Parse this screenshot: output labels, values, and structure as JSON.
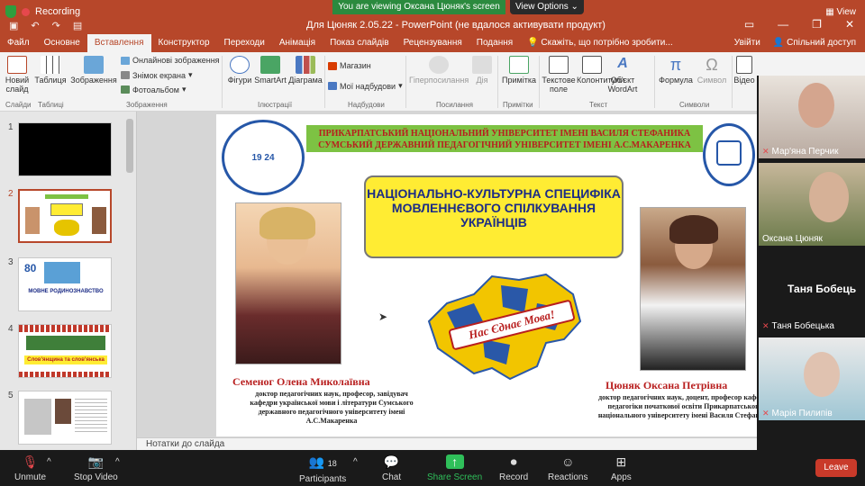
{
  "window": {
    "recording": "Recording",
    "viewing_banner": "You are viewing Оксана Цюняк's screen",
    "view_options": "View Options",
    "doc_title": "Для Цюняк  2.05.22 - PowerPoint (не вдалося активувати продукт)",
    "view_label": "View"
  },
  "tabs": [
    "Файл",
    "Основне",
    "Вставлення",
    "Конструктор",
    "Переходи",
    "Анімація",
    "Показ слайдів",
    "Рецензування",
    "Подання"
  ],
  "active_tab": "Вставлення",
  "tell_me": "Скажіть, що потрібно зробити...",
  "signin": "Увійти",
  "share": "Спільний доступ",
  "ribbon": {
    "new_slide": "Новий слайд",
    "table": "Таблиця",
    "images": "Зображення",
    "online_images": "Онлайнові зображення",
    "screenshot": "Знімок екрана",
    "photo_album": "Фотоальбом",
    "shapes": "Фігури",
    "smartart": "SmartArt",
    "chart": "Діаграма",
    "store": "Магазин",
    "my_addins": "Мої надбудови",
    "hyperlink": "Гіперпосилання",
    "action": "Дія",
    "comment": "Примітка",
    "textbox": "Текстове поле",
    "header_footer": "Колонтитули",
    "wordart": "Об'єкт WordArt",
    "equation": "Формула",
    "symbol": "Символ",
    "video": "Відео",
    "groups": {
      "slides": "Слайди",
      "tables": "Таблиці",
      "images": "Зображення",
      "illustrations": "Ілюстрації",
      "addins": "Надбудови",
      "links": "Посилання",
      "comments": "Примітки",
      "text": "Текст",
      "symbols": "Символи"
    }
  },
  "thumbnails": [
    {
      "num": "1"
    },
    {
      "num": "2"
    },
    {
      "num": "3",
      "caption": "МОВНЕ РОДИНОЗНАВСТВО"
    },
    {
      "num": "4",
      "caption": "Слов'янщина та слов'янська"
    },
    {
      "num": "5"
    }
  ],
  "slide": {
    "uni1": "ПРИКАРПАТСЬКИЙ НАЦІОНАЛЬНИЙ УНІВЕРСИТЕТ ІМЕНІ ВАСИЛЯ СТЕФАНИКА",
    "uni2": "СУМСЬКИЙ ДЕРЖАВНИЙ ПЕДАГОГІЧНИЙ УНІВЕРСИТЕТ ІМЕНІ А.С.МАКАРЕНКА",
    "title": "НАЦІОНАЛЬНО-КУЛЬТУРНА СПЕЦИФІКА МОВЛЕННЄВОГО СПІЛКУВАННЯ УКРАЇНЦІВ",
    "logo_year": "19 24",
    "map_caption": "Нас Єднає Мова!",
    "person1_name": "Семеног Олена Миколаївна",
    "person1_desc": "доктор педагогічних наук, професор, завідувач кафедри української мови і літератури Сумського державного педагогічного університету імені А.С.Макаренка",
    "person2_name": "Цюняк Оксана Петрівна",
    "person2_desc": "доктор педагогічних наук, доцент, професор кафедри педагогіки початкової освіти Прикарпатського національного університету імені Василя Стефаника"
  },
  "notes": "Нотатки до слайда",
  "participants": [
    {
      "name": "Мар'яна Перчик"
    },
    {
      "name": "Оксана Цюняк"
    },
    {
      "name": "Таня Бобецька",
      "center_label": "Таня Бобець"
    },
    {
      "name": "Марія Пилипів"
    }
  ],
  "zoom": {
    "unmute": "Unmute",
    "stop_video": "Stop Video",
    "participants": "Participants",
    "participants_count": "18",
    "chat": "Chat",
    "share_screen": "Share Screen",
    "record": "Record",
    "reactions": "Reactions",
    "apps": "Apps",
    "leave": "Leave"
  },
  "colors": {
    "accent": "#b7472a",
    "share_green": "#2b8a3e",
    "leave_red": "#c93a2a",
    "title_yellow": "#ffec33"
  }
}
